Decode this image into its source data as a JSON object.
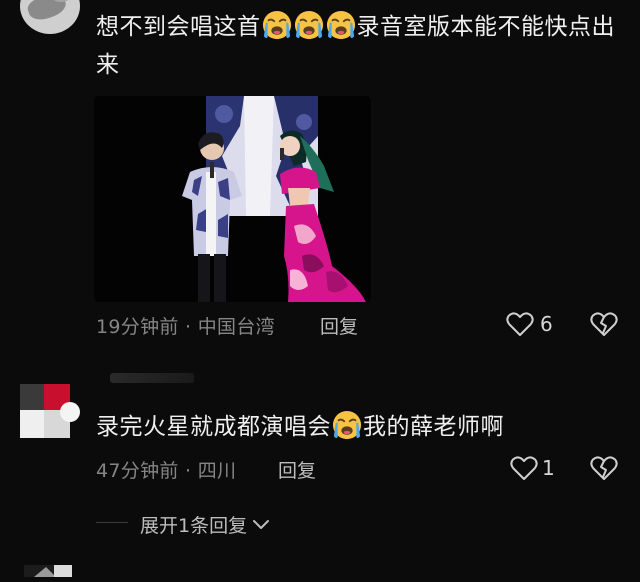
{
  "comments": [
    {
      "text_parts": [
        "想不到会唱这首",
        "录音室版本能不能快点出来"
      ],
      "emoji": "loudly-crying-face",
      "emoji_count": 3,
      "time": "19分钟前",
      "location": "中国台湾",
      "separator": "·",
      "reply_label": "回复",
      "likes": "6"
    },
    {
      "text_parts": [
        "录完火星就成都演唱会",
        "我的薛老师啊"
      ],
      "emoji": "loudly-crying-face",
      "emoji_count": 1,
      "time": "47分钟前",
      "location": "四川",
      "separator": "·",
      "reply_label": "回复",
      "likes": "1"
    }
  ],
  "expand_replies": {
    "label": "展开1条回复",
    "icon": "chevron-down-icon"
  },
  "colors": {
    "background": "#0b0b0b",
    "text": "#efefef",
    "meta": "#858585",
    "emoji_face": "#f6c343",
    "emoji_tears": "#4aa8f0",
    "dress": "#d6148c"
  },
  "icons": {
    "like": "heart-outline-icon",
    "dislike": "broken-heart-icon"
  }
}
